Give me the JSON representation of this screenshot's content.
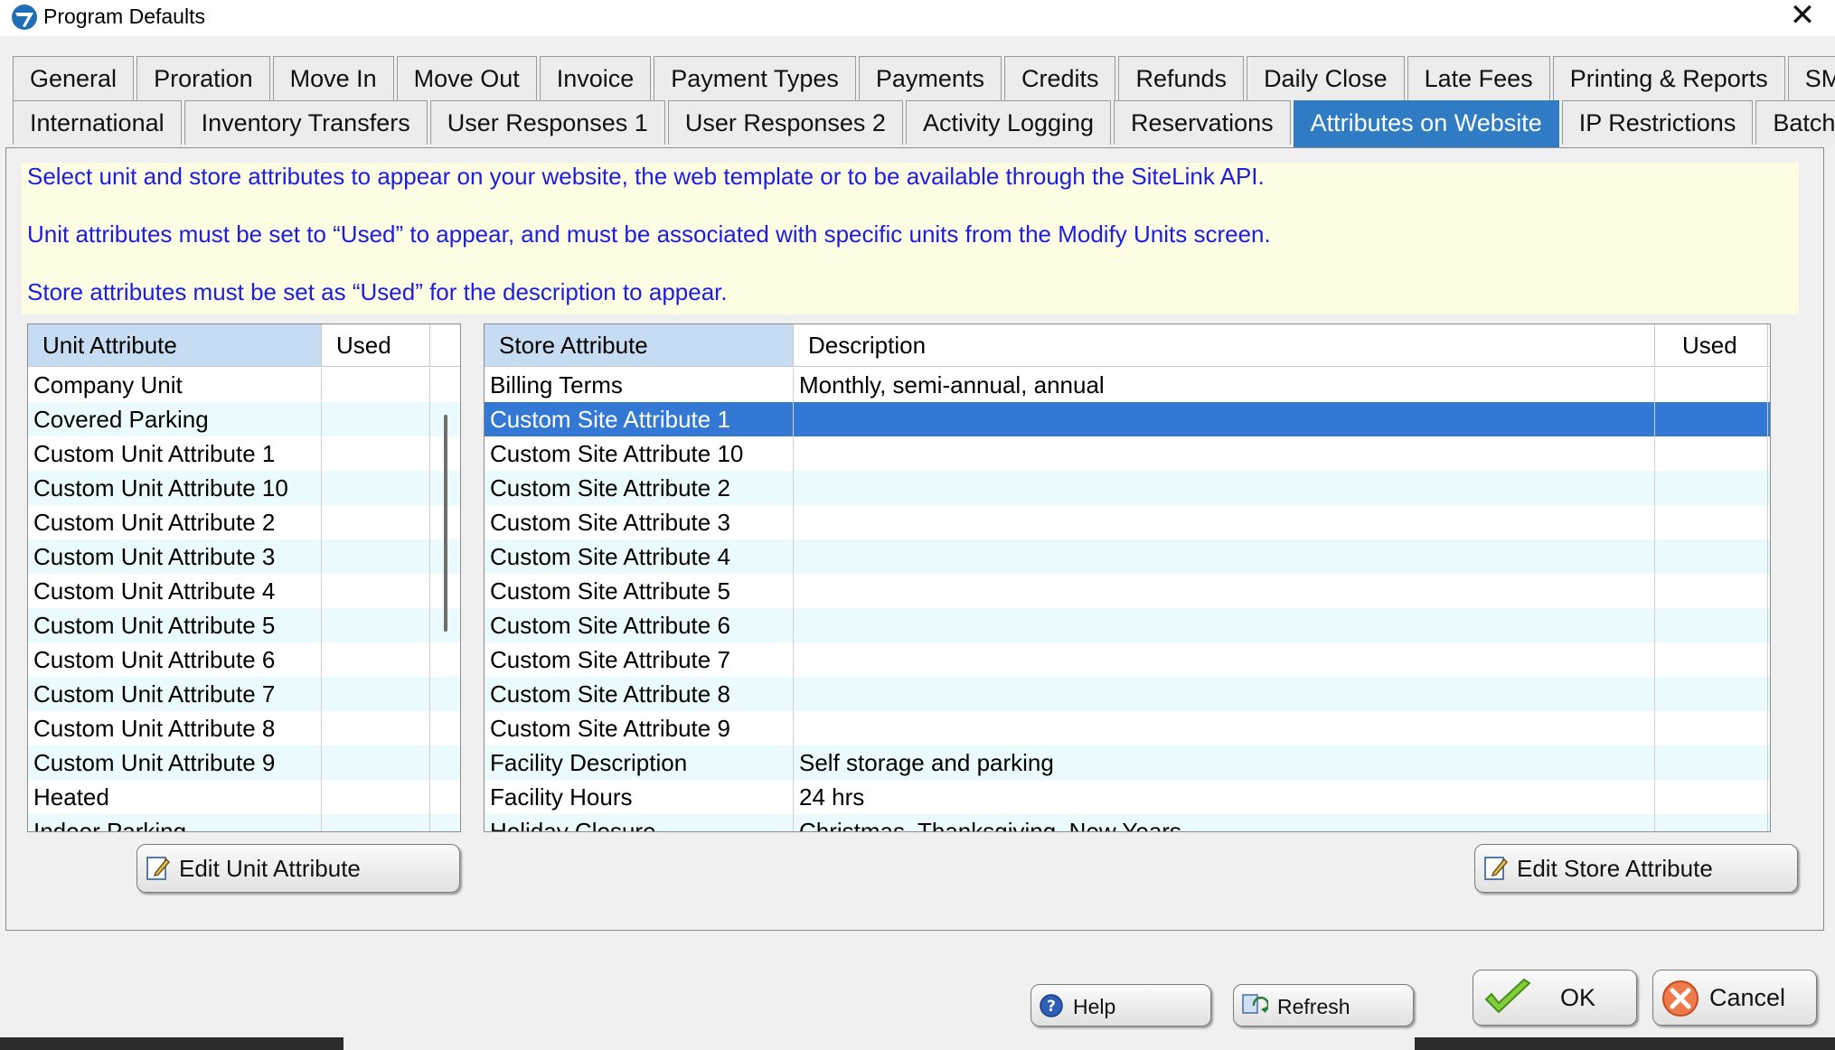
{
  "window": {
    "title": "Program Defaults",
    "close_glyph": "✕",
    "icon": "app-logo-icon"
  },
  "tabs": {
    "row1": [
      "General",
      "Proration",
      "Move In",
      "Move Out",
      "Invoice",
      "Payment Types",
      "Payments",
      "Credits",
      "Refunds",
      "Daily Close",
      "Late Fees",
      "Printing & Reports",
      "SMS"
    ],
    "row2": [
      "International",
      "Inventory Transfers",
      "User Responses 1",
      "User Responses 2",
      "Activity Logging",
      "Reservations",
      "Attributes on Website",
      "IP Restrictions",
      "Batch"
    ],
    "active": "Attributes on Website"
  },
  "info": {
    "line1": "Select unit and store attributes to appear on your website, the web template or to be available through the SiteLink API.",
    "line2": "Unit attributes must be set to “Used” to appear, and must be associated with specific units from the Modify Units screen.",
    "line3": "Store attributes must be set as “Used” for the description to appear."
  },
  "unit_grid": {
    "headers": {
      "attribute": "Unit Attribute",
      "used": "Used"
    },
    "rows": [
      "Company Unit",
      "Covered Parking",
      "Custom Unit Attribute 1",
      "Custom Unit Attribute 10",
      "Custom Unit Attribute 2",
      "Custom Unit Attribute 3",
      "Custom Unit Attribute 4",
      "Custom Unit Attribute 5",
      "Custom Unit Attribute 6",
      "Custom Unit Attribute 7",
      "Custom Unit Attribute 8",
      "Custom Unit Attribute 9",
      "Heated",
      "Indoor Parking"
    ]
  },
  "store_grid": {
    "headers": {
      "attribute": "Store Attribute",
      "description": "Description",
      "used": "Used"
    },
    "rows": [
      {
        "attribute": "Billing Terms",
        "description": "Monthly, semi-annual, annual"
      },
      {
        "attribute": "Custom Site Attribute 1",
        "description": "",
        "selected": true
      },
      {
        "attribute": "Custom Site Attribute 10",
        "description": ""
      },
      {
        "attribute": "Custom Site Attribute 2",
        "description": ""
      },
      {
        "attribute": "Custom Site Attribute 3",
        "description": ""
      },
      {
        "attribute": "Custom Site Attribute 4",
        "description": ""
      },
      {
        "attribute": "Custom Site Attribute 5",
        "description": ""
      },
      {
        "attribute": "Custom Site Attribute 6",
        "description": ""
      },
      {
        "attribute": "Custom Site Attribute 7",
        "description": ""
      },
      {
        "attribute": "Custom Site Attribute 8",
        "description": ""
      },
      {
        "attribute": "Custom Site Attribute 9",
        "description": ""
      },
      {
        "attribute": "Facility Description",
        "description": "Self storage and parking"
      },
      {
        "attribute": "Facility Hours",
        "description": "24 hrs"
      },
      {
        "attribute": "Holiday Closure",
        "description": "Christmas, Thanksgiving, New Years"
      }
    ]
  },
  "buttons": {
    "edit_unit": "Edit Unit Attribute",
    "edit_store": "Edit Store Attribute",
    "help": "Help",
    "refresh": "Refresh",
    "ok": "OK",
    "cancel": "Cancel"
  },
  "colors": {
    "accent": "#2f7bc4",
    "selected_row": "#3378d4",
    "info_text": "#1d1de0",
    "info_bg": "#fdfde3",
    "alt_row": "#ebfafc"
  }
}
